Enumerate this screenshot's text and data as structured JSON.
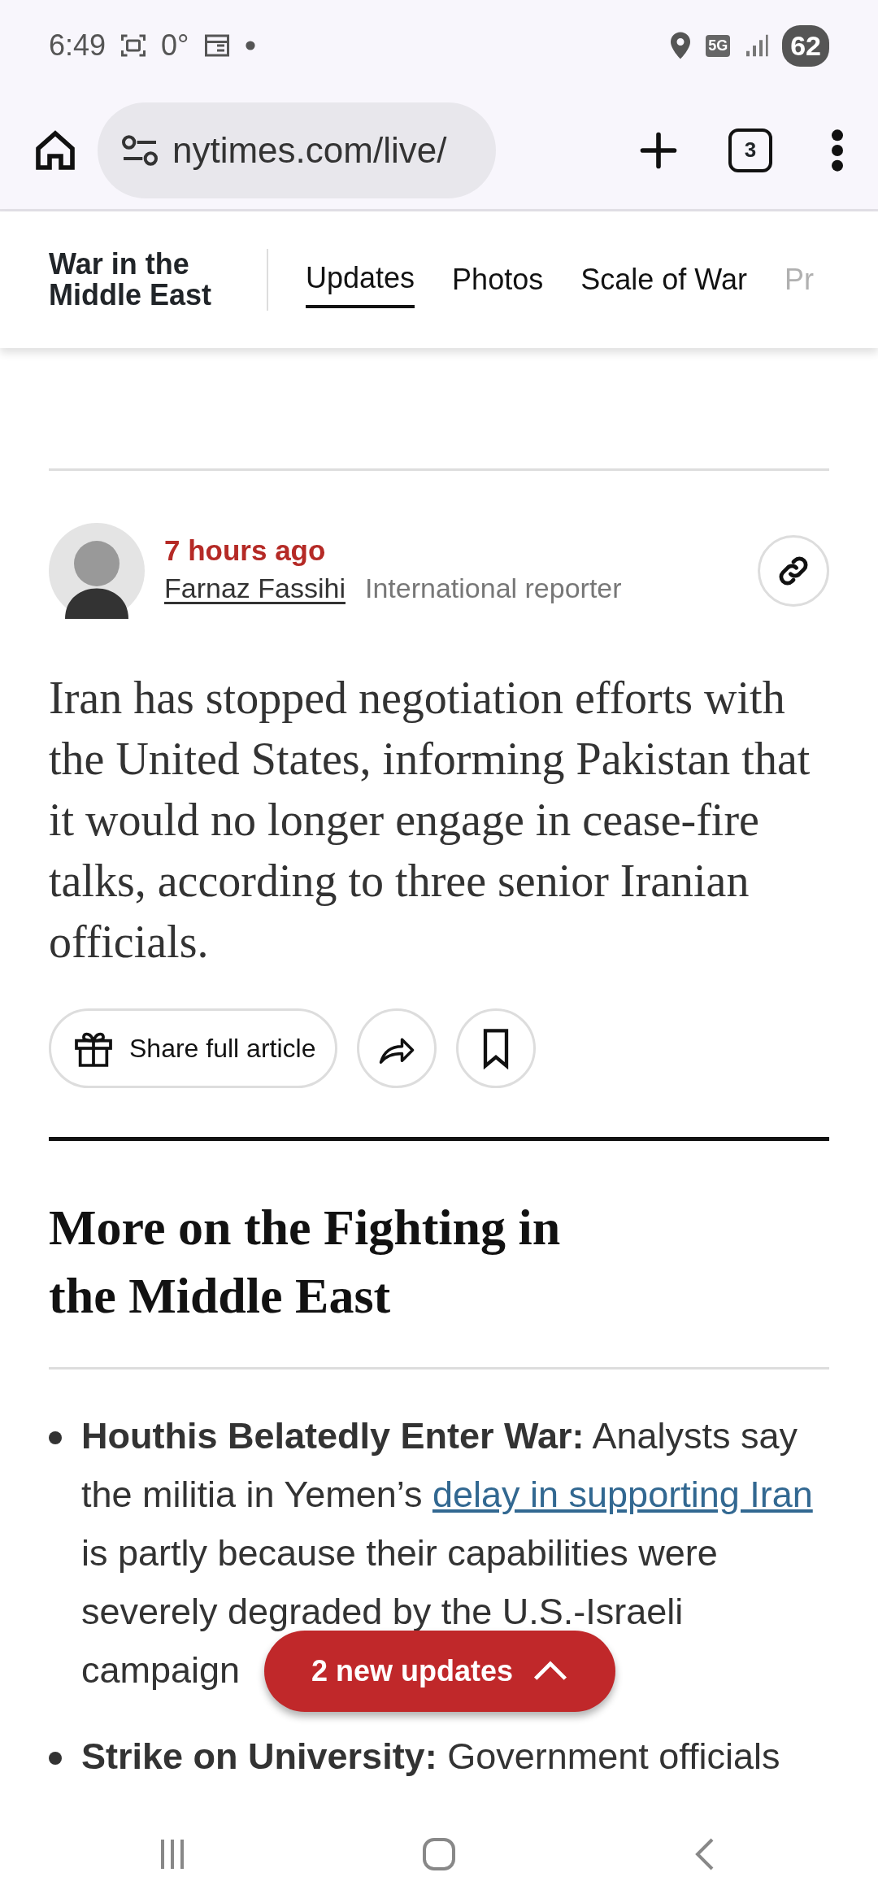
{
  "status_bar": {
    "time": "6:49",
    "temperature": "0°",
    "network": "5G",
    "battery": "62"
  },
  "browser": {
    "url": "nytimes.com/live/",
    "tab_count": "3"
  },
  "section_nav": {
    "title": "War in the Middle East",
    "tabs": [
      {
        "label": "Updates",
        "selected": true
      },
      {
        "label": "Photos",
        "selected": false
      },
      {
        "label": "Scale of War",
        "selected": false
      },
      {
        "label": "Pr",
        "selected": false
      }
    ]
  },
  "post": {
    "time": "7 hours ago",
    "author": "Farnaz Fassihi",
    "role": "International reporter",
    "body": "Iran has stopped negotiation efforts with the United States, informing Pakistan that it would no longer engage in cease-fire talks, according to three senior Iranian officials.",
    "share_label": "Share full article"
  },
  "more": {
    "heading": "More on the Fighting in the Middle East",
    "items": [
      {
        "text": "**Houthis Belatedly Enter War:** Analysts say the militia in Yemen’s",
        "link": "delay in supporting Iran",
        "text_after": "is partly because their capabilities were severely degraded by the U.S.-Israeli campaign"
      },
      {
        "text": "**Strike on University:** Government officials"
      }
    ]
  },
  "updates_pill": {
    "label": "2 new updates"
  }
}
